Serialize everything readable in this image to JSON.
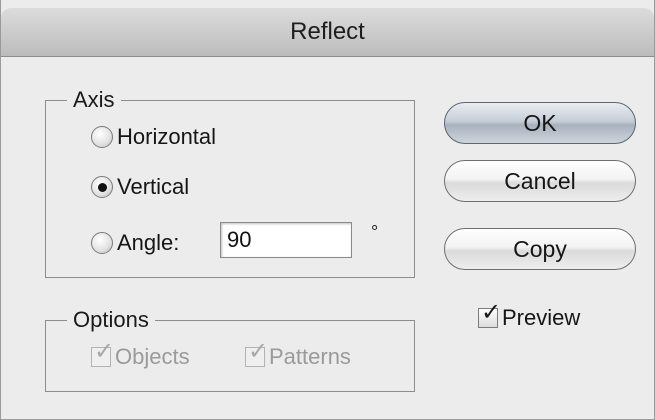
{
  "dialog": {
    "title": "Reflect"
  },
  "axis": {
    "legend": "Axis",
    "options": [
      {
        "label": "Horizontal",
        "selected": false
      },
      {
        "label": "Vertical",
        "selected": true
      },
      {
        "label": "Angle:",
        "selected": false
      }
    ],
    "angle_value": "90",
    "angle_unit": "°"
  },
  "options": {
    "legend": "Options",
    "objects_label": "Objects",
    "patterns_label": "Patterns"
  },
  "buttons": {
    "ok": "OK",
    "cancel": "Cancel",
    "copy": "Copy"
  },
  "preview": {
    "label": "Preview",
    "checked": true
  }
}
